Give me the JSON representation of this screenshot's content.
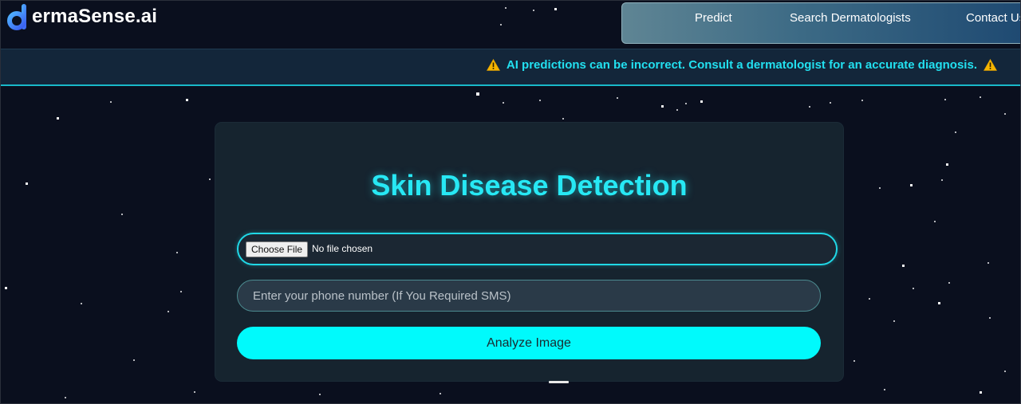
{
  "brand": {
    "name": "ermaSense.ai",
    "logo_icon": "d-logo-icon"
  },
  "nav": {
    "items": [
      {
        "label": "Predict"
      },
      {
        "label": "Search Dermatologists"
      },
      {
        "label": "Contact Us"
      }
    ]
  },
  "warning": {
    "icon": "warning-triangle-icon",
    "text": "AI predictions can be incorrect. Consult a dermatologist for an accurate diagnosis."
  },
  "form": {
    "title": "Skin Disease Detection",
    "file_button_label": "Choose File",
    "file_status": "No file chosen",
    "phone_placeholder": "Enter your phone number (If You Required SMS)",
    "submit_label": "Analyze Image"
  },
  "colors": {
    "accent_cyan": "#00fafc",
    "title_cyan": "#27e8f4",
    "warning_text": "#22e0f0",
    "background": "#0a0f1e",
    "card": "#16242f"
  }
}
